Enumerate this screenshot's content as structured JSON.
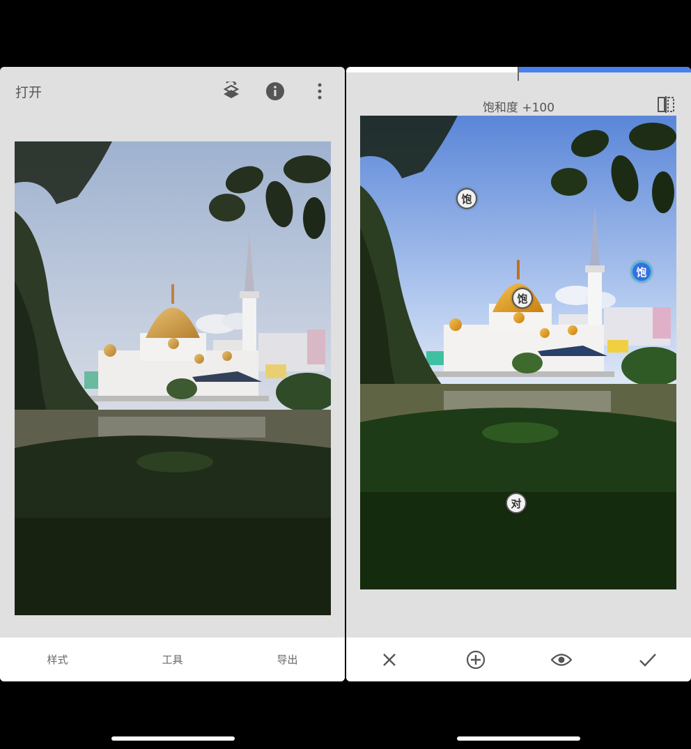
{
  "left": {
    "header": {
      "open_label": "打开"
    },
    "icons": {
      "layers": "layers-stack-icon",
      "info": "info-icon",
      "more": "more-vert-icon"
    },
    "nav": [
      "样式",
      "工具",
      "导出"
    ]
  },
  "right": {
    "adjustment_label": "饱和度 +100",
    "control_points": [
      {
        "label": "饱",
        "active": false
      },
      {
        "label": "饱",
        "active": true
      },
      {
        "label": "饱",
        "active": false
      },
      {
        "label": "对",
        "active": false
      }
    ],
    "slider_value": 1.0,
    "actions": [
      "close-icon",
      "add-circle-icon",
      "eye-icon",
      "check-icon"
    ]
  },
  "colors": {
    "accent": "#4a7ff0",
    "panel_bg": "#e0e0e0"
  }
}
